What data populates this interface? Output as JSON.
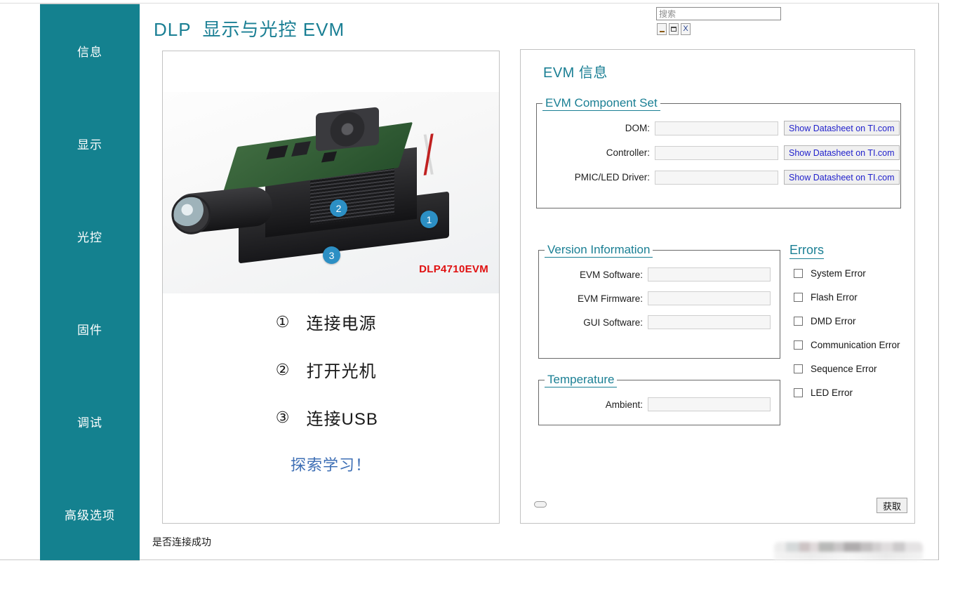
{
  "window": {
    "title": "DLP  显示与光控 EVM",
    "controls": [
      {
        "name": "minimize",
        "label": "_"
      },
      {
        "name": "maximize",
        "label": "□"
      },
      {
        "name": "close",
        "label": "X"
      }
    ]
  },
  "search": {
    "placeholder": "搜索",
    "value": ""
  },
  "sidebar": {
    "items": [
      {
        "label": "信息"
      },
      {
        "label": "显示"
      },
      {
        "label": "光控"
      },
      {
        "label": "固件"
      },
      {
        "label": "调试"
      },
      {
        "label": "高级选项"
      }
    ]
  },
  "left_panel": {
    "photo_label": "DLP4710EVM",
    "callouts": [
      "1",
      "2",
      "3"
    ],
    "steps": [
      {
        "num": "①",
        "text": "连接电源"
      },
      {
        "num": "②",
        "text": "打开光机"
      },
      {
        "num": "③",
        "text": "连接USB"
      }
    ],
    "explore_link": "探索学习！"
  },
  "right_panel": {
    "heading": "EVM 信息",
    "component_set": {
      "legend": "EVM Component Set",
      "rows": [
        {
          "label": "DOM:",
          "value": "",
          "button": "Show Datasheet on TI.com"
        },
        {
          "label": "Controller:",
          "value": "",
          "button": "Show Datasheet on TI.com"
        },
        {
          "label": "PMIC/LED Driver:",
          "value": "",
          "button": "Show Datasheet on TI.com"
        }
      ]
    },
    "version_info": {
      "legend": "Version Information",
      "rows": [
        {
          "label": "EVM Software:",
          "value": ""
        },
        {
          "label": "EVM Firmware:",
          "value": ""
        },
        {
          "label": "GUI Software:",
          "value": ""
        }
      ]
    },
    "temperature": {
      "legend": "Temperature",
      "rows": [
        {
          "label": "Ambient:",
          "value": ""
        }
      ]
    },
    "errors": {
      "heading": "Errors",
      "items": [
        {
          "label": "System Error",
          "checked": false
        },
        {
          "label": "Flash Error",
          "checked": false
        },
        {
          "label": "DMD Error",
          "checked": false
        },
        {
          "label": "Communication Error",
          "checked": false
        },
        {
          "label": "Sequence Error",
          "checked": false
        },
        {
          "label": "LED Error",
          "checked": false
        }
      ]
    },
    "fetch_button": "获取"
  },
  "status_bar": {
    "text": "是否连接成功"
  },
  "colors": {
    "sidebar_teal": "#14818f",
    "heading_teal": "#1a7f94",
    "link_blue": "#2222cc",
    "explore_blue": "#3e6fb5",
    "callout_blue": "#2c8fc4",
    "label_red": "#e01010"
  }
}
